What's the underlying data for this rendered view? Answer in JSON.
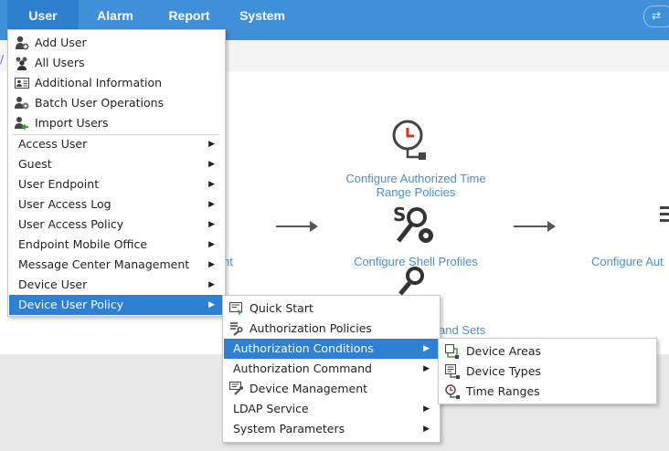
{
  "topbar": {
    "tabs": [
      {
        "label": "User"
      },
      {
        "label": "Alarm"
      },
      {
        "label": "Report"
      },
      {
        "label": "System"
      }
    ]
  },
  "flow": {
    "time_policy": {
      "line1": "Configure Authorized Time",
      "line2": "Range Policies"
    },
    "shell_profiles": "Configure Shell Profiles",
    "command_sets_fragment": "and Sets",
    "left_fragment": "nt",
    "right_fragment": "Configure Aut"
  },
  "user_menu": {
    "icon_items": [
      {
        "label": "Add User",
        "icon": "add-user-icon"
      },
      {
        "label": "All Users",
        "icon": "all-users-icon"
      },
      {
        "label": "Additional Information",
        "icon": "id-card-icon"
      },
      {
        "label": "Batch User Operations",
        "icon": "batch-users-icon"
      },
      {
        "label": "Import Users",
        "icon": "import-users-icon"
      }
    ],
    "submenu_items": [
      {
        "label": "Access User"
      },
      {
        "label": "Guest"
      },
      {
        "label": "User Endpoint"
      },
      {
        "label": "User Access Log"
      },
      {
        "label": "User Access Policy"
      },
      {
        "label": "Endpoint Mobile Office"
      },
      {
        "label": "Message Center Management"
      },
      {
        "label": "Device User"
      },
      {
        "label": "Device User Policy"
      }
    ]
  },
  "policy_menu": {
    "items": [
      {
        "label": "Quick Start",
        "icon": "quick-start-icon"
      },
      {
        "label": "Authorization Policies",
        "icon": "authorization-policies-icon"
      },
      {
        "label": "Authorization Conditions",
        "submenu": true
      },
      {
        "label": "Authorization Command",
        "submenu": true
      },
      {
        "label": "Device Management",
        "icon": "device-management-icon"
      },
      {
        "label": "LDAP Service",
        "submenu": true
      },
      {
        "label": "System Parameters",
        "submenu": true
      }
    ]
  },
  "conditions_menu": {
    "items": [
      {
        "label": "Device Areas",
        "icon": "device-areas-icon"
      },
      {
        "label": "Device Types",
        "icon": "device-types-icon"
      },
      {
        "label": "Time Ranges",
        "icon": "time-ranges-icon"
      }
    ]
  },
  "colors": {
    "topbar": "#3f8fd9",
    "selected": "#2f7fd3",
    "link": "#4d8ec6"
  }
}
